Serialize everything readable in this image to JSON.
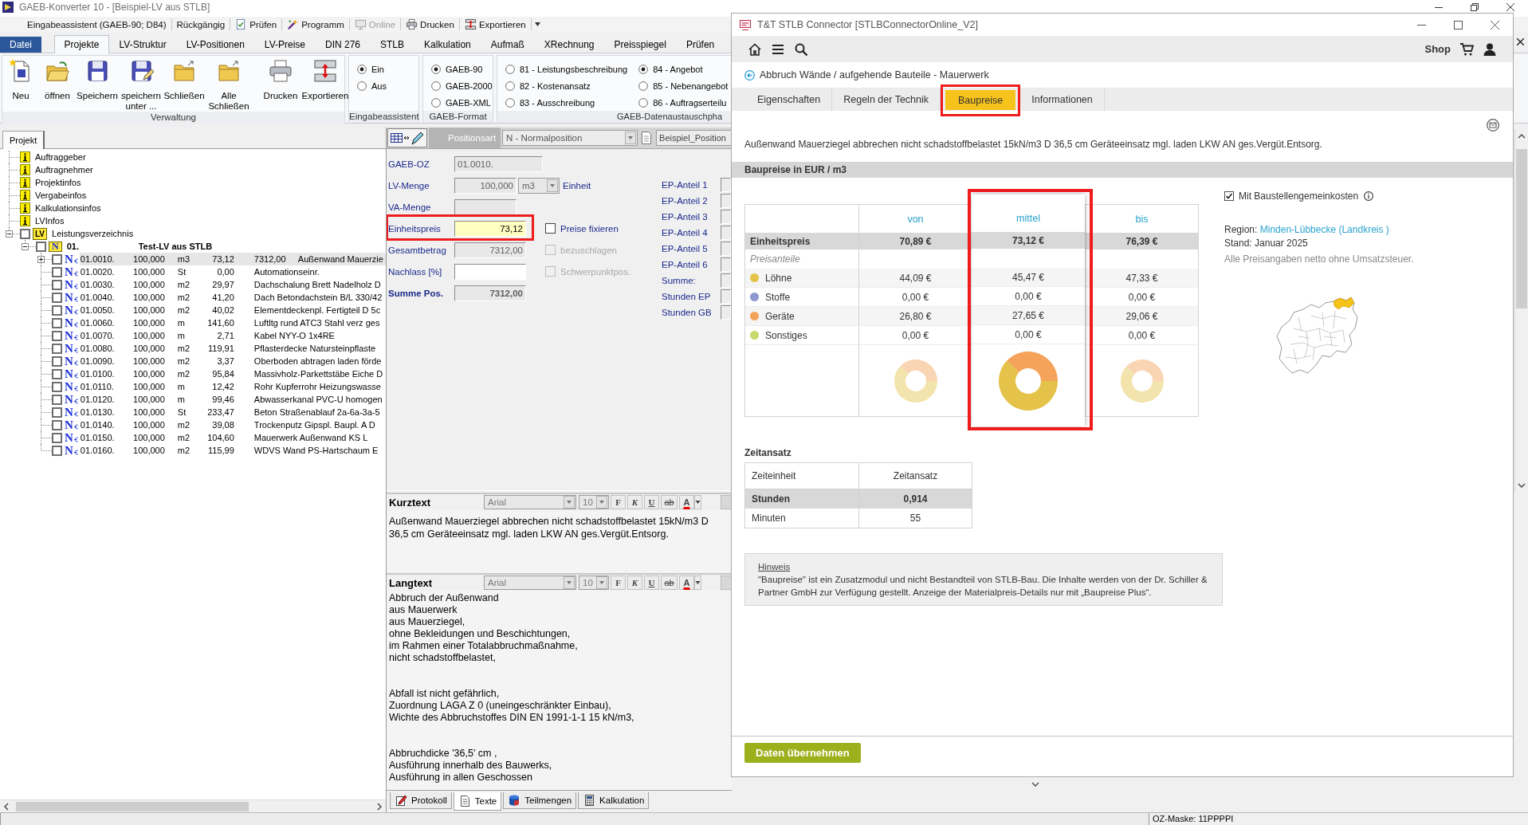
{
  "main_window": {
    "title": "GAEB-Konverter 10 - [Beispiel-LV aus STLB]",
    "quick_access": [
      {
        "label": "Eingabeassistent (GAEB-90; D84)",
        "disabled": false
      },
      {
        "label": "Rückgängig",
        "disabled": false
      },
      {
        "label": "Prüfen",
        "disabled": false
      },
      {
        "label": "Programm",
        "disabled": false
      },
      {
        "label": "Online",
        "disabled": true
      },
      {
        "label": "Drucken",
        "disabled": false
      },
      {
        "label": "Exportieren",
        "disabled": false
      }
    ],
    "file_menu": "Datei",
    "ribbon_tabs": [
      {
        "label": "Projekte",
        "selected": true
      },
      {
        "label": "LV-Struktur",
        "selected": false
      },
      {
        "label": "LV-Positionen",
        "selected": false
      },
      {
        "label": "LV-Preise",
        "selected": false
      },
      {
        "label": "DIN 276",
        "selected": false
      },
      {
        "label": "STLB",
        "selected": false
      },
      {
        "label": "Kalkulation",
        "selected": false
      },
      {
        "label": "Aufmaß",
        "selected": false
      },
      {
        "label": "XRechnung",
        "selected": false
      },
      {
        "label": "Preisspiegel",
        "selected": false
      },
      {
        "label": "Prüfen",
        "selected": false
      }
    ],
    "ribbon_groups": [
      {
        "kind": "buttons",
        "label": "Verwaltung",
        "buttons": [
          "Neu",
          "öffnen",
          "Speichern",
          "speichern unter ...",
          "Schließen",
          "Alle Schließen",
          "Drucken",
          "Exportieren"
        ]
      },
      {
        "kind": "radios",
        "label": "Eingabeassistent",
        "options": [
          {
            "label": "Ein",
            "selected": true
          },
          {
            "label": "Aus",
            "selected": false
          }
        ]
      },
      {
        "kind": "radios",
        "label": "GAEB-Format",
        "options": [
          {
            "label": "GAEB-90",
            "selected": true
          },
          {
            "label": "GAEB-2000",
            "selected": false
          },
          {
            "label": "GAEB-XML",
            "selected": false
          }
        ]
      },
      {
        "kind": "radios",
        "label": "GAEB-Datenaustauschpha",
        "options": [
          {
            "label": "81 - Leistungsbeschreibung",
            "selected": false
          },
          {
            "label": "82 - Kostenansatz",
            "selected": false
          },
          {
            "label": "83 - Ausschreibung",
            "selected": false
          },
          {
            "label": "84 - Angebot",
            "selected": true
          },
          {
            "label": "85 - Nebenangebot",
            "selected": false
          },
          {
            "label": "86 - Auftragserteilu",
            "selected": false
          }
        ]
      }
    ]
  },
  "project_tree": {
    "tabs": [
      {
        "label": "Projekt",
        "selected": true
      }
    ],
    "items": [
      {
        "kind": "info",
        "label": "Auftraggeber"
      },
      {
        "kind": "info",
        "label": "Auftragnehmer"
      },
      {
        "kind": "info",
        "label": "Projektinfos"
      },
      {
        "kind": "info",
        "label": "Vergabeinfos"
      },
      {
        "kind": "info",
        "label": "Kalkulationsinfos"
      },
      {
        "kind": "info",
        "label": "LVInfos"
      },
      {
        "kind": "catalog",
        "label": "Leistungsverzeichnis",
        "folder_mark": "LV",
        "expanded": true,
        "checked": false,
        "children": [
          {
            "kind": "group",
            "number": "01.",
            "label": "Test-LV aus STLB",
            "folder_mark": "N",
            "expanded": true,
            "checked": false,
            "children": [
              {
                "kind": "position",
                "type_mark": "N",
                "oz": "01.0010.",
                "quantity": "100,000",
                "unit": "m3",
                "unit_price": "73,12",
                "total": "7312,00",
                "description": "Außenwand Mauerzie",
                "expanded": false,
                "checked": false,
                "selected": true
              },
              {
                "kind": "position",
                "type_mark": "N",
                "oz": "01.0020.",
                "quantity": "100,000",
                "unit": "St",
                "unit_price": "0,00",
                "description": "Automationseinr.",
                "checked": false,
                "selected": false
              },
              {
                "kind": "position",
                "type_mark": "N",
                "oz": "01.0030.",
                "quantity": "100,000",
                "unit": "m2",
                "unit_price": "29,97",
                "description": "Dachschalung Brett Nadelholz D",
                "checked": false,
                "selected": false
              },
              {
                "kind": "position",
                "type_mark": "N",
                "oz": "01.0040.",
                "quantity": "100,000",
                "unit": "m2",
                "unit_price": "41,20",
                "description": "Dach Betondachstein B/L 330/42",
                "checked": false,
                "selected": false
              },
              {
                "kind": "position",
                "type_mark": "N",
                "oz": "01.0050.",
                "quantity": "100,000",
                "unit": "m2",
                "unit_price": "40,02",
                "description": "Elementdeckenpl. Fertigteil D 5c",
                "checked": false,
                "selected": false
              },
              {
                "kind": "position",
                "type_mark": "N",
                "oz": "01.0060.",
                "quantity": "100,000",
                "unit": "m",
                "unit_price": "141,60",
                "description": "Luftltg rund ATC3 Stahl verz ges",
                "checked": false,
                "selected": false
              },
              {
                "kind": "position",
                "type_mark": "N",
                "oz": "01.0070.",
                "quantity": "100,000",
                "unit": "m",
                "unit_price": "2,71",
                "description": "Kabel NYY-O 1x4RE",
                "checked": false,
                "selected": false
              },
              {
                "kind": "position",
                "type_mark": "N",
                "oz": "01.0080.",
                "quantity": "100,000",
                "unit": "m2",
                "unit_price": "119,91",
                "description": "Pflasterdecke Natursteinpflaste",
                "checked": false,
                "selected": false
              },
              {
                "kind": "position",
                "type_mark": "N",
                "oz": "01.0090.",
                "quantity": "100,000",
                "unit": "m2",
                "unit_price": "3,37",
                "description": "Oberboden abtragen laden förde",
                "checked": false,
                "selected": false
              },
              {
                "kind": "position",
                "type_mark": "N",
                "oz": "01.0100.",
                "quantity": "100,000",
                "unit": "m2",
                "unit_price": "95,84",
                "description": "Massivholz-Parkettstäbe Eiche D",
                "checked": false,
                "selected": false
              },
              {
                "kind": "position",
                "type_mark": "N",
                "oz": "01.0110.",
                "quantity": "100,000",
                "unit": "m",
                "unit_price": "12,42",
                "description": "Rohr Kupferrohr Heizungswasse",
                "checked": false,
                "selected": false
              },
              {
                "kind": "position",
                "type_mark": "N",
                "oz": "01.0120.",
                "quantity": "100,000",
                "unit": "m",
                "unit_price": "99,46",
                "description": "Abwasserkanal PVC-U homogen",
                "checked": false,
                "selected": false
              },
              {
                "kind": "position",
                "type_mark": "N",
                "oz": "01.0130.",
                "quantity": "100,000",
                "unit": "St",
                "unit_price": "233,47",
                "description": "Beton Straßenablauf 2a-6a-3a-5",
                "checked": false,
                "selected": false
              },
              {
                "kind": "position",
                "type_mark": "N",
                "oz": "01.0140.",
                "quantity": "100,000",
                "unit": "m2",
                "unit_price": "39,08",
                "description": "Trockenputz Gipspl. Baupl. A D",
                "checked": false,
                "selected": false
              },
              {
                "kind": "position",
                "type_mark": "N",
                "oz": "01.0150.",
                "quantity": "100,000",
                "unit": "m2",
                "unit_price": "104,60",
                "description": "Mauerwerk Außenwand KS L",
                "checked": false,
                "selected": false
              },
              {
                "kind": "position",
                "type_mark": "N",
                "oz": "01.0160.",
                "quantity": "100,000",
                "unit": "m2",
                "unit_price": "115,99",
                "description": "WDVS Wand PS-Hartschaum E",
                "checked": false,
                "selected": false
              }
            ]
          }
        ]
      }
    ]
  },
  "position_editor": {
    "toolbar": {
      "type_label": "Positionsart",
      "type_value": "N - Normalposition",
      "template": "Beispiel_Position"
    },
    "fields": [
      {
        "kind": "readonly",
        "label": "GAEB-OZ",
        "value": "01.0010.",
        "highlighted": false
      },
      {
        "kind": "readonly",
        "label": "LV-Menge",
        "value": "100,000",
        "unit": "m3",
        "unit_link": "Einheit",
        "highlighted": false
      },
      {
        "kind": "readonly",
        "label": "VA-Menge",
        "highlighted": false
      },
      {
        "kind": "current",
        "label": "Einheitspreis",
        "value": "73,12",
        "highlighted": true,
        "option": {
          "label": "Preise fixieren",
          "checked": false,
          "disabled": false
        }
      },
      {
        "kind": "readonly",
        "label": "Gesamtbetrag",
        "value": "7312,00",
        "highlighted": false,
        "option": {
          "label": "bezuschlagen",
          "checked": false,
          "disabled": true
        }
      },
      {
        "kind": "input",
        "label": "Nachlass [%]",
        "highlighted": false,
        "option": {
          "label": "Schwerpunktpos.",
          "checked": false,
          "disabled": true
        }
      },
      {
        "kind": "total",
        "label": "Summe Pos.",
        "value": "7312,00",
        "highlighted": false
      }
    ],
    "cost_shares": [
      "EP-Anteil 1",
      "EP-Anteil 2",
      "EP-Anteil 3",
      "EP-Anteil 4",
      "EP-Anteil 5",
      "EP-Anteil 6",
      "Summe:",
      "Stunden EP",
      "Stunden GB"
    ],
    "short_text": {
      "title": "Kurztext",
      "font": "Arial",
      "size": "10",
      "format_buttons": [
        "F",
        "K",
        "U",
        "ab",
        "A"
      ],
      "text": "Außenwand Mauerziegel abbrechen nicht schadstoffbelastet 15kN/m3 D 36,5 cm Geräteeinsatz mgl. laden LKW AN ges.Vergüt.Entsorg."
    },
    "long_text": {
      "title": "Langtext",
      "font": "Arial",
      "size": "10",
      "format_buttons": [
        "F",
        "K",
        "U",
        "ab",
        "A"
      ],
      "paragraphs": [
        [
          "Abbruch der Außenwand",
          "aus Mauerwerk",
          "aus Mauerziegel,",
          "ohne Bekleidungen und Beschichtungen,",
          "im Rahmen einer Totalabbruchmaßnahme,",
          "nicht schadstoffbelastet,"
        ],
        [
          "Abfall ist nicht gefährlich,",
          "Zuordnung LAGA Z 0 (uneingeschränkter Einbau),",
          "Wichte des Abbruchstoffes DIN EN 1991-1-1 15 kN/m3,"
        ],
        [
          "Abbruchdicke '36,5' cm ,",
          "Ausführung innerhalb des Bauwerks,",
          "Ausführung in allen Geschossen"
        ]
      ]
    },
    "bottom_tabs": [
      {
        "label": "Protokoll",
        "selected": false
      },
      {
        "label": "Texte",
        "selected": true
      },
      {
        "label": "Teilmengen",
        "selected": false
      },
      {
        "label": "Kalkulation",
        "selected": false
      }
    ]
  },
  "status_bar": {
    "mask": "OZ-Maske: 11PPPPI"
  },
  "connector": {
    "title": "T&T STLB Connector [STLBConnectorOnline_V2]",
    "shop_label": "Shop",
    "breadcrumb": "Abbruch Wände / aufgehende Bauteile - Mauerwerk",
    "tabs": [
      {
        "label": "Eigenschaften",
        "selected": false,
        "highlighted": false
      },
      {
        "label": "Regeln der Technik",
        "selected": false,
        "highlighted": false
      },
      {
        "label": "Baupreise",
        "selected": true,
        "highlighted": true
      },
      {
        "label": "Informationen",
        "selected": false,
        "highlighted": false
      }
    ],
    "description": "Außenwand Mauerziegel abbrechen nicht schadstoffbelastet 15kN/m3 D 36,5 cm Geräteeinsatz mgl. laden LKW AN ges.Vergüt.Entsorg.",
    "price_section": {
      "title": "Baupreise in EUR / m3",
      "columns": [
        {
          "label": "von",
          "selected": false,
          "highlighted": false
        },
        {
          "label": "mittel",
          "selected": true,
          "highlighted": true
        },
        {
          "label": "bis",
          "selected": false,
          "highlighted": false
        }
      ],
      "unit_price": {
        "label": "Einheitspreis",
        "values": [
          "70,89 €",
          "73,12 €",
          "76,39 €"
        ]
      },
      "shares_label": "Preisanteile",
      "shares": [
        {
          "label": "Löhne",
          "color": "#e5c24a",
          "values": [
            "44,09 €",
            "45,47 €",
            "47,33 €"
          ]
        },
        {
          "label": "Stoffe",
          "color": "#8e98cf",
          "values": [
            "0,00 €",
            "0,00 €",
            "0,00 €"
          ]
        },
        {
          "label": "Geräte",
          "color": "#f5a35a",
          "values": [
            "26,80 €",
            "27,65 €",
            "29,06 €"
          ]
        },
        {
          "label": "Sonstiges",
          "color": "#c9d86a",
          "values": [
            "0,00 €",
            "0,00 €",
            "0,00 €"
          ]
        }
      ],
      "surcharge_option": {
        "label": "Mit Baustellengemeinkosten",
        "checked": true
      },
      "region_label": "Region:",
      "region": "Minden-Lübbecke (Landkreis )",
      "stand": "Stand: Januar 2025",
      "note": "Alle Preisangaben netto ohne Umsatzsteuer."
    },
    "time_section": {
      "title": "Zeitansatz",
      "header": [
        "Zeiteinheit",
        "Zeitansatz"
      ],
      "rows": [
        {
          "label": "Stunden",
          "value": "0,914",
          "emphasis": true
        },
        {
          "label": "Minuten",
          "value": "55",
          "emphasis": false
        }
      ]
    },
    "notice": {
      "title": "Hinweis",
      "text": "\"Baupreise\" ist ein Zusatzmodul und nicht Bestandteil von STLB-Bau. Die Inhalte werden von der Dr. Schiller & Partner GmbH zur Verfügung gestellt. Anzeige der Materialpreis-Details nur mit „Baupreise Plus“."
    },
    "apply_button": "Daten übernehmen"
  }
}
